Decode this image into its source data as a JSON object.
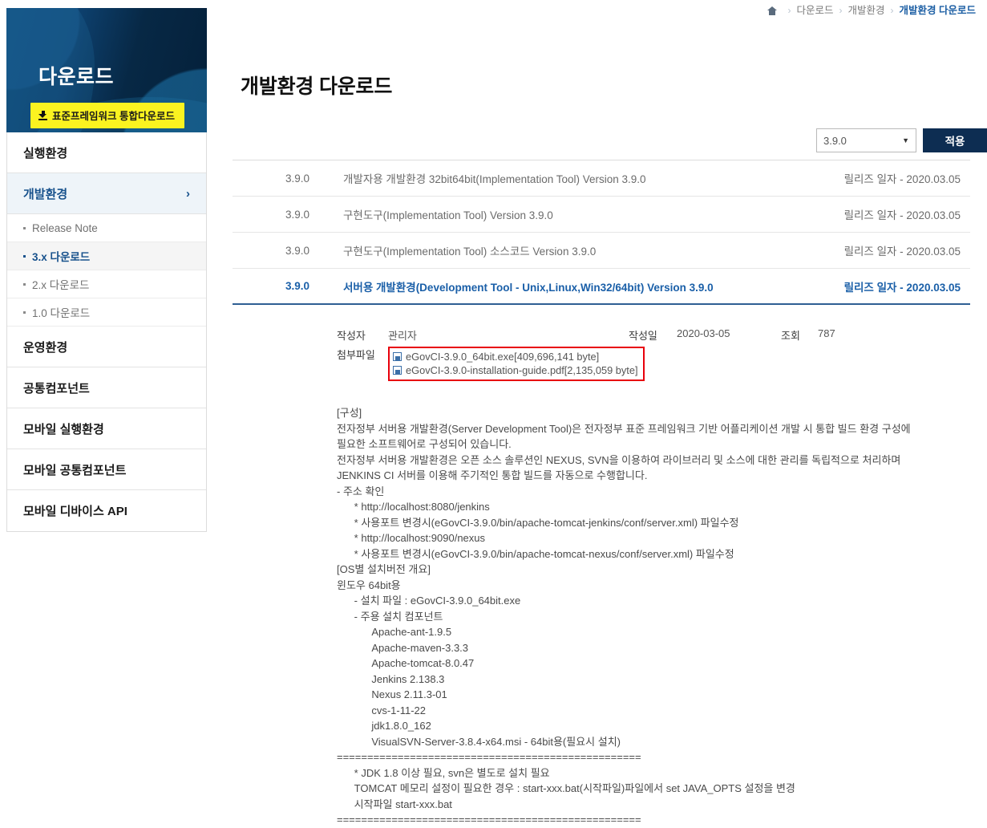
{
  "breadcrumb": {
    "home_icon": "home-icon",
    "items": [
      "다운로드",
      "개발환경",
      "개발환경 다운로드"
    ],
    "separator": "›"
  },
  "sidebar": {
    "title": "다운로드",
    "download_button": {
      "label": "표준프레임워크 통합다운로드",
      "icon": "download-arrow-icon",
      "bg": "#fbf320"
    },
    "items": [
      {
        "label": "실행환경",
        "active": false
      },
      {
        "label": "개발환경",
        "active": true,
        "chevron": "›"
      },
      {
        "label": "운영환경",
        "active": false
      },
      {
        "label": "공통컴포넌트",
        "active": false
      },
      {
        "label": "모바일 실행환경",
        "active": false
      },
      {
        "label": "모바일 공통컴포넌트",
        "active": false
      },
      {
        "label": "모바일 디바이스 API",
        "active": false
      }
    ],
    "sub_items": [
      {
        "label": "Release Note",
        "active": false
      },
      {
        "label": "3.x 다운로드",
        "active": true
      },
      {
        "label": "2.x 다운로드",
        "active": false
      },
      {
        "label": "1.0 다운로드",
        "active": false
      }
    ]
  },
  "main": {
    "page_title": "개발환경 다운로드",
    "filter": {
      "selected_version": "3.9.0",
      "caret_icon": "chevron-down-icon",
      "apply_label": "적용",
      "apply_bg": "#0d2d52"
    },
    "table": {
      "rows": [
        {
          "version": "3.9.0",
          "name": "개발자용 개발환경 32bit64bit(Implementation Tool) Version 3.9.0",
          "date": "릴리즈 일자 - 2020.03.05",
          "selected": false
        },
        {
          "version": "3.9.0",
          "name": "구현도구(Implementation Tool) Version 3.9.0",
          "date": "릴리즈 일자 - 2020.03.05",
          "selected": false
        },
        {
          "version": "3.9.0",
          "name": "구현도구(Implementation Tool) 소스코드 Version 3.9.0",
          "date": "릴리즈 일자 - 2020.03.05",
          "selected": false
        },
        {
          "version": "3.9.0",
          "name": "서버용 개발환경(Development Tool - Unix,Linux,Win32/64bit) Version 3.9.0",
          "date": "릴리즈 일자 - 2020.03.05",
          "selected": true
        }
      ]
    },
    "detail": {
      "author_label": "작성자",
      "author_value": "관리자",
      "date_label": "작성일",
      "date_value": "2020-03-05",
      "views_label": "조회",
      "views_value": "787",
      "attach_label": "첨부파일",
      "attach_border_color": "#e8000b",
      "attachments": [
        "eGovCI-3.9.0_64bit.exe[409,696,141 byte]",
        "eGovCI-3.9.0-installation-guide.pdf[2,135,059 byte]"
      ],
      "description": "[구성]\n전자정부 서버용 개발환경(Server Development Tool)은 전자정부 표준 프레임워크 기반 어플리케이션 개발 시 통합 빌드 환경 구성에\n필요한 소프트웨어로 구성되어 있습니다.\n전자정부 서버용 개발환경은 오픈 소스 솔루션인 NEXUS, SVN을 이용하여 라이브러리 및 소스에 대한 관리를 독립적으로 처리하며\nJENKINS CI 서버를 이용해 주기적인 통합 빌드를 자동으로 수행합니다.\n- 주소 확인\n      * http://localhost:8080/jenkins\n      * 사용포트 변경시(eGovCI-3.9.0/bin/apache-tomcat-jenkins/conf/server.xml) 파일수정\n      * http://localhost:9090/nexus\n      * 사용포트 변경시(eGovCI-3.9.0/bin/apache-tomcat-nexus/conf/server.xml) 파일수정\n[OS별 설치버전 개요]\n윈도우 64bit용\n      - 설치 파일 : eGovCI-3.9.0_64bit.exe\n      - 주용 설치 컴포넌트\n            Apache-ant-1.9.5\n            Apache-maven-3.3.3\n            Apache-tomcat-8.0.47\n            Jenkins 2.138.3\n            Nexus 2.11.3-01\n            cvs-1-11-22\n            jdk1.8.0_162\n            VisualSVN-Server-3.8.4-x64.msi - 64bit용(필요시 설치)\n==================================================\n      * JDK 1.8 이상 필요, svn은 별도로 설치 필요\n      TOMCAT 메모리 설정이 필요한 경우 : start-xxx.bat(시작파일)파일에서 set JAVA_OPTS 설정을 변경\n      시작파일 start-xxx.bat\n=================================================="
    }
  }
}
